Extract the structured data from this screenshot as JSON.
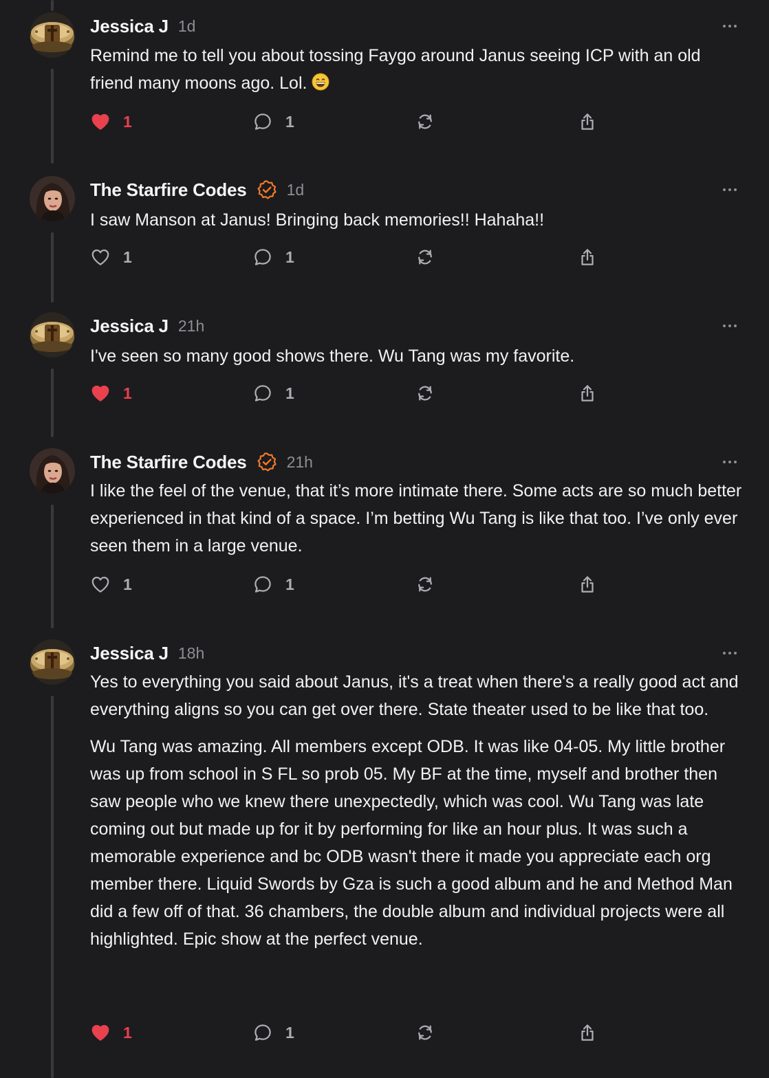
{
  "colors": {
    "background": "#1c1c1e",
    "like_active": "#e9414e",
    "verified": "#f5792a",
    "muted": "#8e8e93"
  },
  "posts": [
    {
      "author": "Jessica J",
      "time": "1d",
      "verified": false,
      "avatar": "ring-avatar",
      "paragraphs": [
        "Remind me to tell you about tossing Faygo around Janus seeing ICP with an old friend many moons ago. Lol."
      ],
      "emoji": "grinning-face",
      "likes": "1",
      "liked": true,
      "replies": "1"
    },
    {
      "author": "The Starfire Codes",
      "time": "1d",
      "verified": true,
      "avatar": "portrait-avatar",
      "paragraphs": [
        "I saw Manson at Janus! Bringing back memories!! Hahaha!!"
      ],
      "likes": "1",
      "liked": false,
      "replies": "1"
    },
    {
      "author": "Jessica J",
      "time": "21h",
      "verified": false,
      "avatar": "ring-avatar",
      "paragraphs": [
        "I've seen so many good shows there. Wu Tang was my favorite."
      ],
      "likes": "1",
      "liked": true,
      "replies": "1"
    },
    {
      "author": "The Starfire Codes",
      "time": "21h",
      "verified": true,
      "avatar": "portrait-avatar",
      "paragraphs": [
        "I like the feel of the venue, that it’s more intimate there. Some acts are so much better experienced in that kind of a space. I’m betting Wu Tang is like that too. I’ve only ever seen them in a large venue."
      ],
      "likes": "1",
      "liked": false,
      "replies": "1"
    },
    {
      "author": "Jessica J",
      "time": "18h",
      "verified": false,
      "avatar": "ring-avatar",
      "paragraphs": [
        "Yes to everything you said about Janus, it's a treat when there's a really good act and everything aligns so you can get over there. State theater used to be like that too.",
        "Wu Tang was amazing. All members except ODB. It was like 04-05. My little brother was up from school in S FL so prob 05. My BF at the time, myself and brother then saw people who we knew there unexpectedly, which was cool. Wu Tang was late coming out but made up for it by performing for like an hour plus. It was such a memorable experience and bc ODB wasn't there it made you appreciate each org member there. Liquid Swords by Gza is such a good album and he and Method Man did a few off of that. 36 chambers, the double album and individual projects were all highlighted. Epic show at the perfect venue."
      ],
      "likes": "1",
      "liked": true,
      "replies": "1"
    }
  ]
}
